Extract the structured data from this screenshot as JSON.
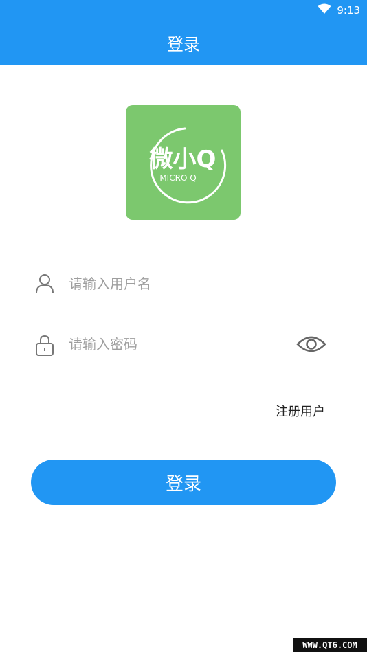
{
  "status_bar": {
    "time": "9:13",
    "wifi_icon": "wifi-icon"
  },
  "app_bar": {
    "title": "登录"
  },
  "logo": {
    "main_text": "微小Q",
    "sub_text": "MICRO Q",
    "background": "#7CC86E"
  },
  "form": {
    "username": {
      "placeholder": "请输入用户名",
      "value": "",
      "icon": "user-icon"
    },
    "password": {
      "placeholder": "请输入密码",
      "value": "",
      "icon": "lock-icon",
      "toggle_icon": "eye-icon"
    },
    "register_label": "注册用户",
    "login_label": "登录"
  },
  "watermark": "WWW.QT6.COM",
  "colors": {
    "primary": "#2196F3",
    "divider": "#d6d6d6",
    "placeholder": "#9e9e9e"
  }
}
